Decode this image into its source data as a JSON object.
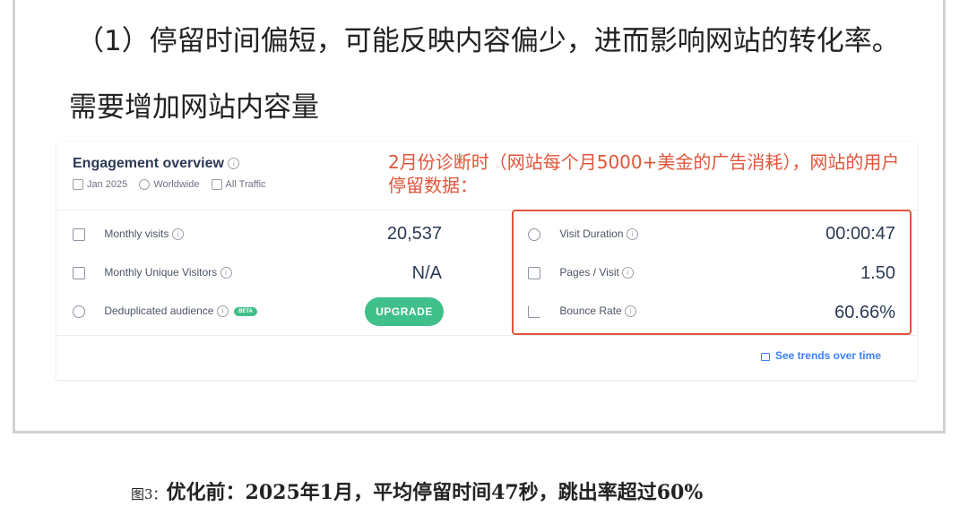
{
  "heading": {
    "line1": "（1）停留时间偏短，可能反映内容偏少，进而影响网站的转化率。",
    "line2": "需要增加网站内容量"
  },
  "card": {
    "title": "Engagement overview",
    "info_glyph": "i",
    "meta": {
      "date": "Jan 2025",
      "region": "Worldwide",
      "traffic": "All Traffic"
    },
    "annotation": "2月份诊断时（网站每个月5000+美金的广告消耗），网站的用户停留数据：",
    "left_metrics": [
      {
        "label": "Monthly visits",
        "value": "20,537",
        "icon": "calendar-icon"
      },
      {
        "label": "Monthly Unique Visitors",
        "value": "N/A",
        "icon": "user-card-icon"
      },
      {
        "label": "Deduplicated audience",
        "value": "",
        "icon": "people-icon",
        "badge": "BETA"
      }
    ],
    "upgrade_label": "UPGRADE",
    "right_metrics": [
      {
        "label": "Visit Duration",
        "value": "00:00:47",
        "icon": "clock-icon"
      },
      {
        "label": "Pages / Visit",
        "value": "1.50",
        "icon": "pages-icon"
      },
      {
        "label": "Bounce Rate",
        "value": "60.66%",
        "icon": "trend-icon"
      }
    ],
    "trends_link": "See trends over time"
  },
  "caption": {
    "prefix": "图3：",
    "text": "优化前：2025年1月，平均停留时间47秒，跳出率超过60%"
  },
  "colors": {
    "annotation": "#e0553b",
    "accent_green": "#3fbf8a",
    "link_blue": "#3b82f6"
  }
}
